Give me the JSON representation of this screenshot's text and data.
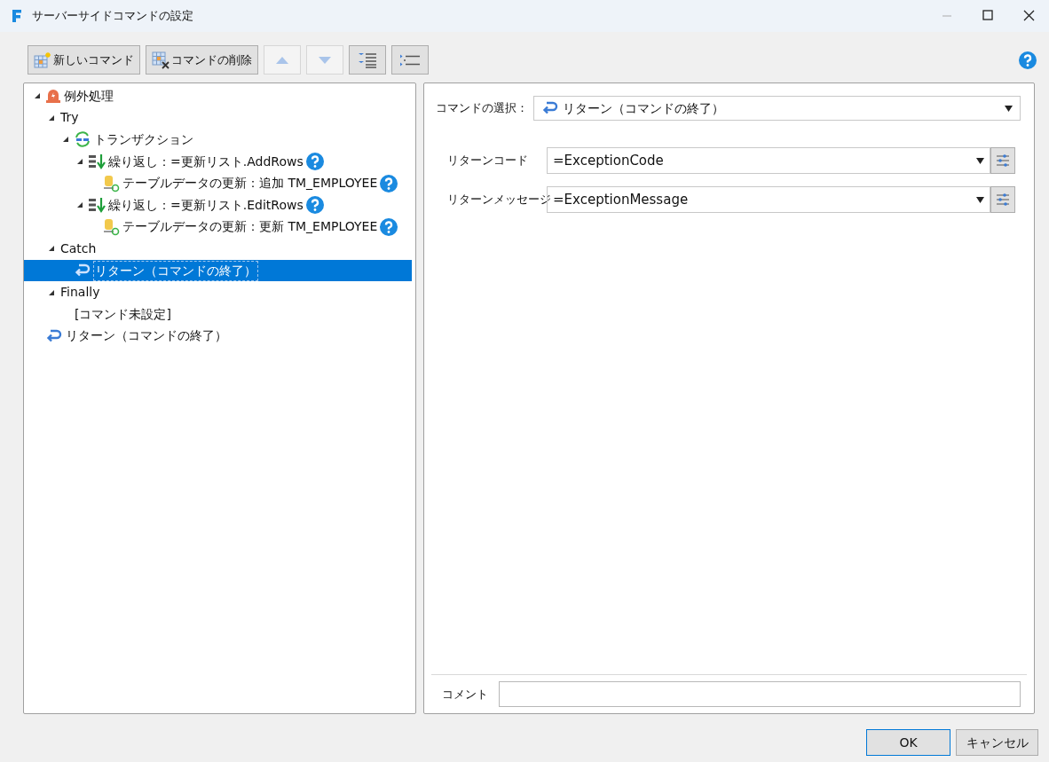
{
  "window": {
    "title": "サーバーサイドコマンドの設定"
  },
  "toolbar": [
    {
      "kind": "new",
      "label": "新しいコマンド",
      "disabled": false
    },
    {
      "kind": "delete",
      "label": "コマンドの削除",
      "disabled": false
    },
    {
      "kind": "up",
      "disabled": true
    },
    {
      "kind": "down",
      "disabled": true
    },
    {
      "kind": "expand-all",
      "disabled": false
    },
    {
      "kind": "collapse-all",
      "disabled": false
    }
  ],
  "tree": [
    {
      "label": "例外処理",
      "kind": "exception",
      "expanded": true,
      "selected": false,
      "help": false,
      "children": [
        {
          "label": "Try",
          "expanded": true,
          "selected": false,
          "help": false,
          "children": [
            {
              "label": "トランザクション",
              "kind": "transaction",
              "expanded": true,
              "selected": false,
              "help": false,
              "children": [
                {
                  "label": "繰り返し：=更新リスト.AddRows",
                  "kind": "loop",
                  "expanded": true,
                  "selected": false,
                  "help": true,
                  "children": [
                    {
                      "label": "テーブルデータの更新：追加 TM_EMPLOYEE",
                      "kind": "table-update",
                      "selected": false,
                      "help": true
                    }
                  ]
                },
                {
                  "label": "繰り返し：=更新リスト.EditRows",
                  "kind": "loop",
                  "expanded": true,
                  "selected": false,
                  "help": true,
                  "children": [
                    {
                      "label": "テーブルデータの更新：更新 TM_EMPLOYEE",
                      "kind": "table-update",
                      "selected": false,
                      "help": true
                    }
                  ]
                }
              ]
            }
          ]
        },
        {
          "label": "Catch",
          "expanded": true,
          "selected": false,
          "help": false,
          "children": [
            {
              "label": "リターン（コマンドの終了）",
              "kind": "return",
              "selected": true,
              "help": false
            }
          ]
        },
        {
          "label": "Finally",
          "expanded": true,
          "selected": false,
          "help": false,
          "children": [
            {
              "label": "[コマンド未設定]",
              "selected": false,
              "help": false
            }
          ]
        }
      ]
    },
    {
      "label": "リターン（コマンドの終了）",
      "kind": "return",
      "selected": false,
      "help": false
    }
  ],
  "command_select": {
    "label": "コマンドの選択：",
    "value": "リターン（コマンドの終了）",
    "kind": "return"
  },
  "properties": [
    {
      "label": "リターンコード",
      "value": "=ExceptionCode"
    },
    {
      "label": "リターンメッセージ",
      "value": "=ExceptionMessage"
    }
  ],
  "comment": {
    "label": "コメント"
  },
  "buttons": [
    {
      "label": "OK",
      "default": true
    },
    {
      "label": "キャンセル",
      "default": false
    }
  ]
}
